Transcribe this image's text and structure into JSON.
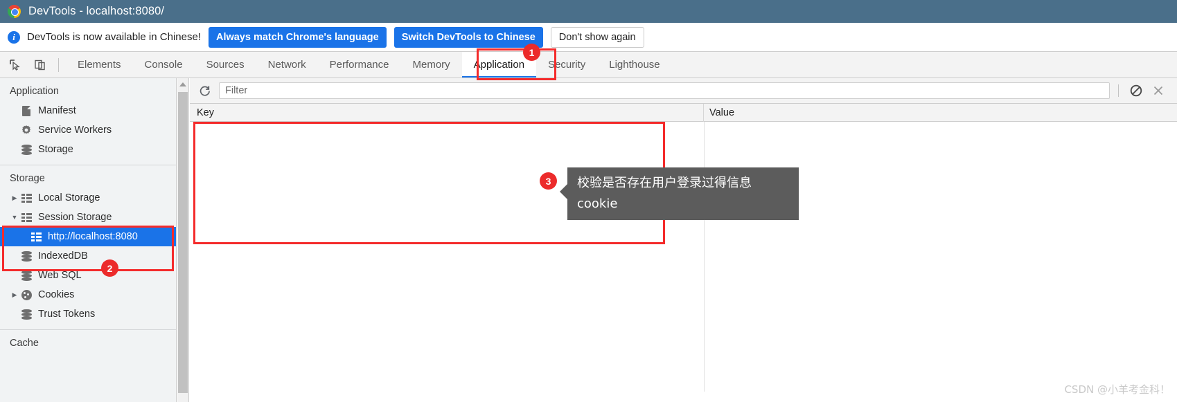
{
  "window": {
    "title": "DevTools - localhost:8080/",
    "logo_icon": "chrome-logo-icon"
  },
  "infobar": {
    "icon": "info-icon",
    "message": "DevTools is now available in Chinese!",
    "buttons": [
      {
        "label": "Always match Chrome's language",
        "style": "primary"
      },
      {
        "label": "Switch DevTools to Chinese",
        "style": "primary"
      },
      {
        "label": "Don't show again",
        "style": "secondary"
      }
    ]
  },
  "tabstrip": {
    "inspect_icon": "inspect-element-icon",
    "device_icon": "toggle-device-toolbar-icon",
    "tabs": [
      {
        "label": "Elements",
        "active": false
      },
      {
        "label": "Console",
        "active": false
      },
      {
        "label": "Sources",
        "active": false
      },
      {
        "label": "Network",
        "active": false
      },
      {
        "label": "Performance",
        "active": false
      },
      {
        "label": "Memory",
        "active": false
      },
      {
        "label": "Application",
        "active": true
      },
      {
        "label": "Security",
        "active": false
      },
      {
        "label": "Lighthouse",
        "active": false
      }
    ]
  },
  "sidebar": {
    "sections": [
      {
        "title": "Application",
        "items": [
          {
            "label": "Manifest",
            "icon": "document-icon",
            "arrow": "",
            "selected": false,
            "child": false
          },
          {
            "label": "Service Workers",
            "icon": "gear-icon",
            "arrow": "",
            "selected": false,
            "child": false
          },
          {
            "label": "Storage",
            "icon": "database-icon",
            "arrow": "",
            "selected": false,
            "child": false
          }
        ]
      },
      {
        "title": "Storage",
        "items": [
          {
            "label": "Local Storage",
            "icon": "table-icon",
            "arrow": "collapsed",
            "selected": false,
            "child": false
          },
          {
            "label": "Session Storage",
            "icon": "table-icon",
            "arrow": "expanded",
            "selected": false,
            "child": false
          },
          {
            "label": "http://localhost:8080",
            "icon": "table-icon",
            "arrow": "",
            "selected": true,
            "child": true
          },
          {
            "label": "IndexedDB",
            "icon": "database-icon",
            "arrow": "",
            "selected": false,
            "child": false
          },
          {
            "label": "Web SQL",
            "icon": "database-icon",
            "arrow": "",
            "selected": false,
            "child": false
          },
          {
            "label": "Cookies",
            "icon": "cookie-icon",
            "arrow": "collapsed",
            "selected": false,
            "child": false
          },
          {
            "label": "Trust Tokens",
            "icon": "database-icon",
            "arrow": "",
            "selected": false,
            "child": false
          }
        ]
      },
      {
        "title": "Cache",
        "items": []
      }
    ],
    "scrollbar_up_icon": "scroll-up-arrow-icon"
  },
  "main": {
    "toolbar": {
      "refresh_icon": "refresh-icon",
      "filter_placeholder": "Filter",
      "filter_value": "",
      "clear_all_icon": "clear-all-icon",
      "delete_selected_icon": "delete-selected-icon"
    },
    "table": {
      "columns": [
        "Key",
        "Value"
      ],
      "rows": []
    }
  },
  "annotations": {
    "badges": [
      {
        "number": "1",
        "target": "application-tab"
      },
      {
        "number": "2",
        "target": "session-storage-origin"
      },
      {
        "number": "3",
        "target": "storage-table-body"
      }
    ],
    "tooltip": {
      "text": "校验是否存在用户登录过得信息cookie"
    },
    "highlight_color": "#f42b2b"
  },
  "watermark": {
    "text": "CSDN @小羊考金科！"
  }
}
